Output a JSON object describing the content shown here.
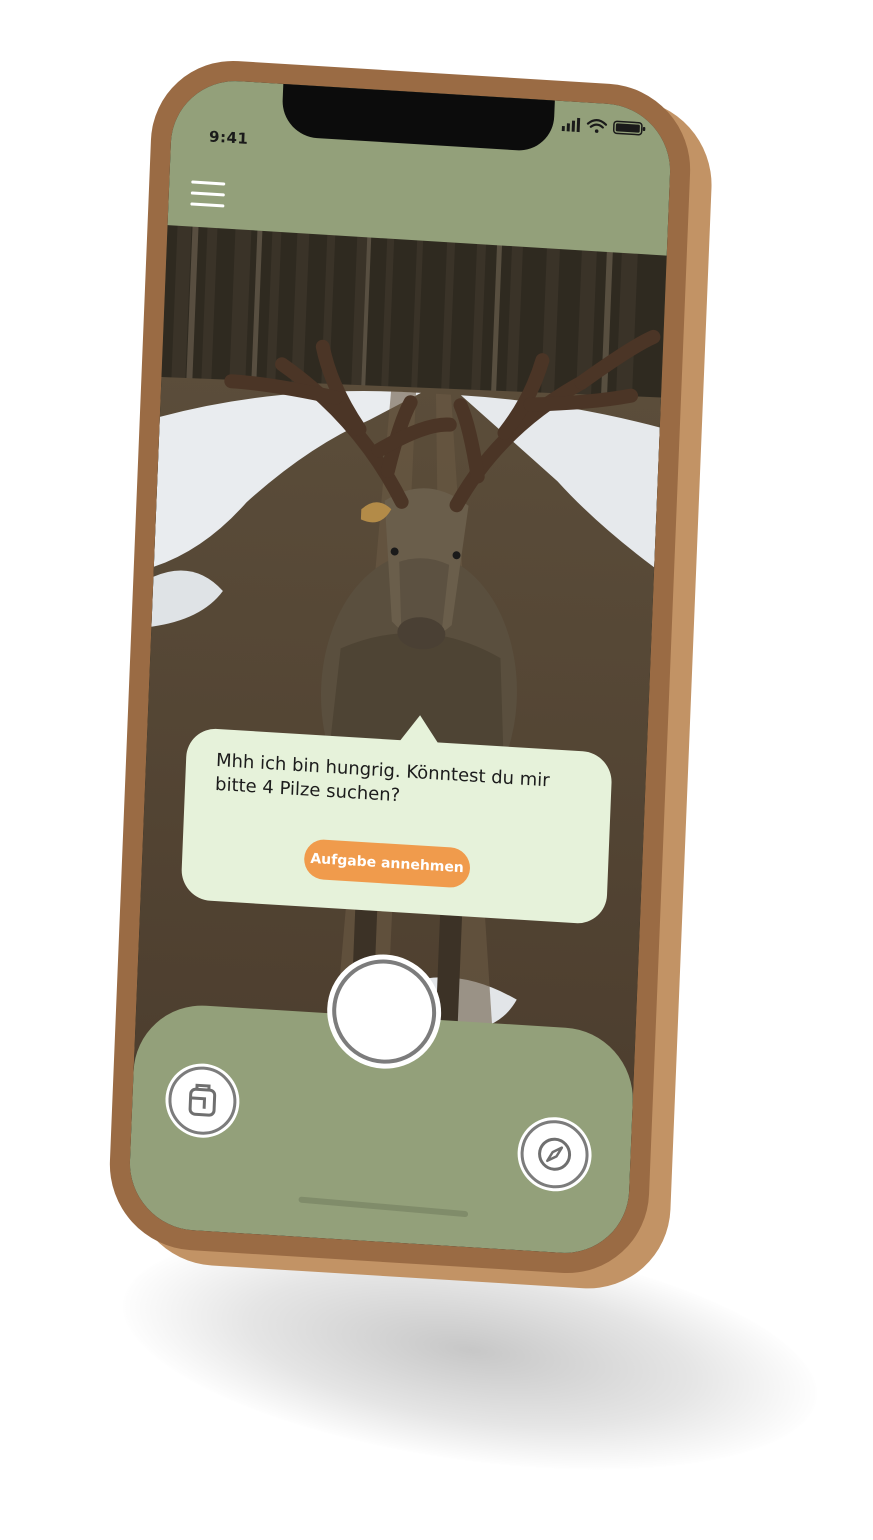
{
  "status_bar": {
    "time": "9:41",
    "icons": [
      "signal-icon",
      "wifi-icon",
      "battery-icon"
    ]
  },
  "header": {
    "menu_icon": "hamburger-menu-icon"
  },
  "dialog": {
    "message": "Mhh ich bin hungrig. Könntest du mir bitte 4 Pilze suchen?",
    "accept_label": "Aufgabe annehmen"
  },
  "bottom_bar": {
    "left_icon": "backpack-icon",
    "center": "camera-capture-button",
    "right_icon": "compass-icon"
  },
  "colors": {
    "header_green": "#93a07a",
    "bubble_bg": "#e6f2da",
    "accent_orange": "#f09b4c",
    "phone_frame": "#9a6b44",
    "phone_side": "#c29365"
  }
}
